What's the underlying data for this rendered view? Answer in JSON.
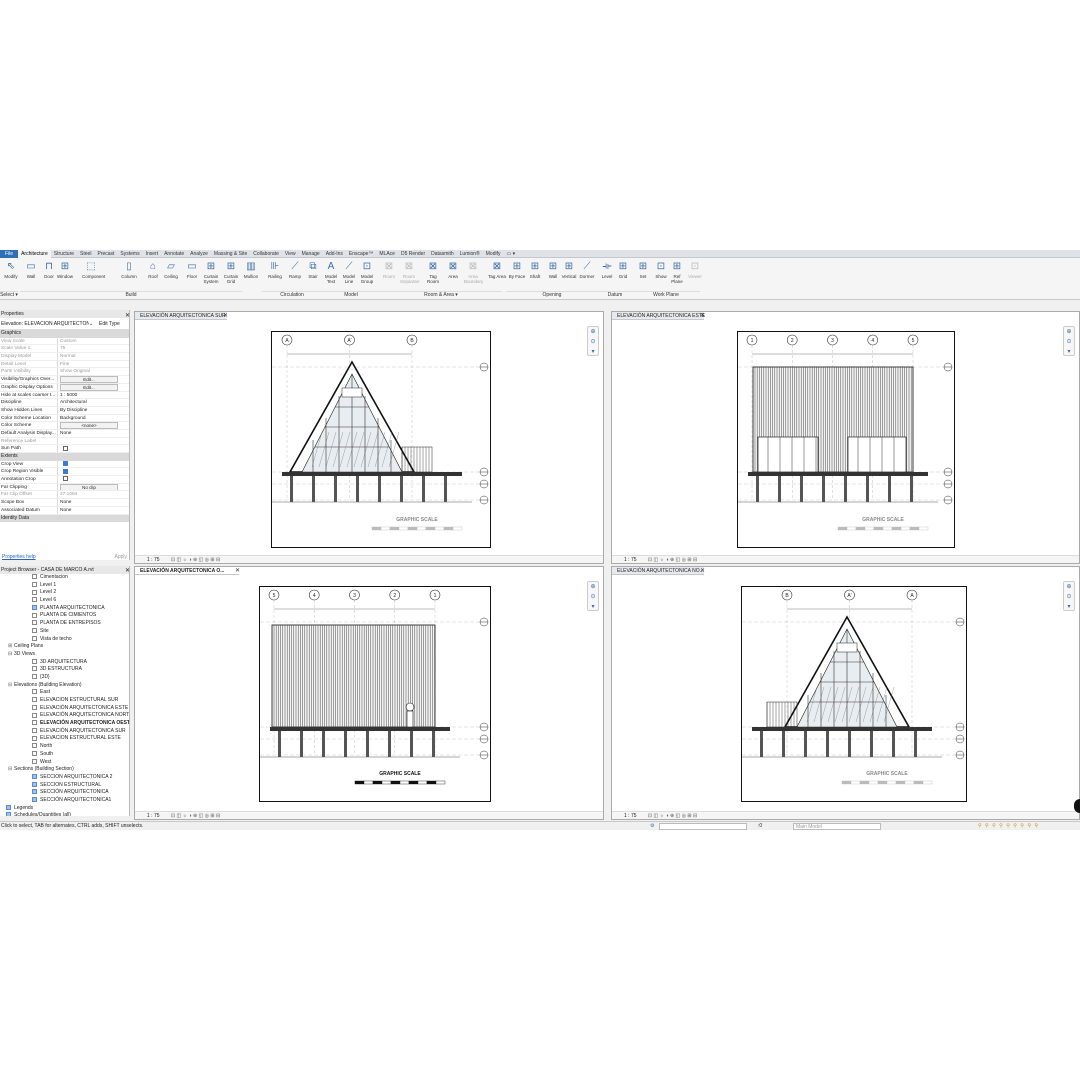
{
  "ribbon_tabs": [
    "File",
    "Architecture",
    "Structure",
    "Steel",
    "Precast",
    "Systems",
    "Insert",
    "Annotate",
    "Analyze",
    "Massing & Site",
    "Collaborate",
    "View",
    "Manage",
    "Add-Ins",
    "Enscape™",
    "MLAce",
    "D5 Render",
    "Datasmith",
    "Lumion®",
    "Modify"
  ],
  "ribbon_buttons": [
    {
      "label": "Modify",
      "icon": "cursor-icon"
    },
    {
      "label": "Wall",
      "icon": "wall-icon"
    },
    {
      "label": "Door",
      "icon": "door-icon"
    },
    {
      "label": "Window",
      "icon": "window-icon"
    },
    {
      "label": "Component",
      "icon": "component-icon"
    },
    {
      "label": "Column",
      "icon": "column-icon"
    },
    {
      "label": "Roof",
      "icon": "roof-icon"
    },
    {
      "label": "Ceiling",
      "icon": "ceiling-icon"
    },
    {
      "label": "Floor",
      "icon": "floor-icon"
    },
    {
      "label": "Curtain System",
      "icon": "curtain-system-icon"
    },
    {
      "label": "Curtain Grid",
      "icon": "curtain-grid-icon"
    },
    {
      "label": "Mullion",
      "icon": "mullion-icon"
    },
    {
      "label": "Railing",
      "icon": "railing-icon"
    },
    {
      "label": "Ramp",
      "icon": "ramp-icon"
    },
    {
      "label": "Stair",
      "icon": "stair-icon"
    },
    {
      "label": "Model Text",
      "icon": "model-text-icon"
    },
    {
      "label": "Model Line",
      "icon": "model-line-icon"
    },
    {
      "label": "Model Group",
      "icon": "model-group-icon"
    },
    {
      "label": "Room",
      "icon": "room-icon",
      "dim": true
    },
    {
      "label": "Room Separator",
      "icon": "room-separator-icon",
      "dim": true
    },
    {
      "label": "Tag Room",
      "icon": "tag-room-icon"
    },
    {
      "label": "Area",
      "icon": "area-icon"
    },
    {
      "label": "Area Boundary",
      "icon": "area-boundary-icon",
      "dim": true
    },
    {
      "label": "Tag Area",
      "icon": "tag-area-icon"
    },
    {
      "label": "By Face",
      "icon": "by-face-icon"
    },
    {
      "label": "Shaft",
      "icon": "shaft-icon"
    },
    {
      "label": "Wall",
      "icon": "wall-opening-icon"
    },
    {
      "label": "Vertical",
      "icon": "vertical-opening-icon"
    },
    {
      "label": "Dormer",
      "icon": "dormer-icon"
    },
    {
      "label": "Level",
      "icon": "level-icon"
    },
    {
      "label": "Grid",
      "icon": "grid-icon"
    },
    {
      "label": "Set",
      "icon": "set-icon"
    },
    {
      "label": "Show",
      "icon": "show-icon"
    },
    {
      "label": "Ref Plane",
      "icon": "ref-plane-icon"
    },
    {
      "label": "Viewer",
      "icon": "viewer-icon",
      "dim": true
    }
  ],
  "ribbon_groups": [
    "Select ▾",
    "Build",
    "Circulation",
    "Model",
    "Room & Area ▾",
    "Opening",
    "Datum",
    "Work Plane"
  ],
  "properties": {
    "title": "Properties",
    "type_selector": "Elevation: ELEVACIÓN ARQUITECTONICA",
    "edit_type": "Edit Type",
    "sections": {
      "graphics": "Graphics",
      "extents": "Extents",
      "identity": "Identity Data"
    },
    "graphics_rows": [
      {
        "k": "View Scale",
        "v": "Custom",
        "grey": true
      },
      {
        "k": "Scale Value    1:",
        "v": "75",
        "grey": true
      },
      {
        "k": "Display Model",
        "v": "Normal",
        "grey": true
      },
      {
        "k": "Detail Level",
        "v": "Fine",
        "grey": true
      },
      {
        "k": "Parts Visibility",
        "v": "Show Original",
        "grey": true
      },
      {
        "k": "Visibility/Graphics Over...",
        "v": "Edit...",
        "btn": true
      },
      {
        "k": "Graphic Display Options",
        "v": "Edit...",
        "btn": true
      },
      {
        "k": "Hide at scales coarser t...",
        "v": "1 : 5000"
      },
      {
        "k": "Discipline",
        "v": "Architectural"
      },
      {
        "k": "Show Hidden Lines",
        "v": "By Discipline"
      },
      {
        "k": "Color Scheme Location",
        "v": "Background"
      },
      {
        "k": "Color Scheme",
        "v": "<none>",
        "btn": true
      },
      {
        "k": "Default Analysis Display...",
        "v": "None"
      },
      {
        "k": "Reference Label",
        "v": "",
        "grey": true
      },
      {
        "k": "Sun Path",
        "v": "",
        "check": false
      }
    ],
    "extents_rows": [
      {
        "k": "Crop View",
        "v": "",
        "check": true
      },
      {
        "k": "Crop Region Visible",
        "v": "",
        "check": true
      },
      {
        "k": "Annotation Crop",
        "v": "",
        "check": false
      },
      {
        "k": "Far Clipping",
        "v": "No clip",
        "btn": true
      },
      {
        "k": "Far Clip Offset",
        "v": "27.1084",
        "grey": true
      },
      {
        "k": "Scope Box",
        "v": "None"
      },
      {
        "k": "Associated Datum",
        "v": "None"
      }
    ],
    "help": "Properties help",
    "apply": "Apply"
  },
  "browser": {
    "title": "Project Browser - CASA DE MARCO A.rvt",
    "items": [
      {
        "t": "Cimentacion",
        "lvl": 2,
        "icon": "sq"
      },
      {
        "t": "Level 1",
        "lvl": 2,
        "icon": "sq"
      },
      {
        "t": "Level 2",
        "lvl": 2,
        "icon": "sq"
      },
      {
        "t": "Level 6",
        "lvl": 2,
        "icon": "sq"
      },
      {
        "t": "PLANTA ARQUITECTONICA",
        "lvl": 2,
        "icon": "bl"
      },
      {
        "t": "PLANTA DE CIMIENTOS",
        "lvl": 2,
        "icon": "sq"
      },
      {
        "t": "PLANTA DE ENTREPISOS",
        "lvl": 2,
        "icon": "sq"
      },
      {
        "t": "Site",
        "lvl": 2,
        "icon": "sq"
      },
      {
        "t": "Vista de techo",
        "lvl": 2,
        "icon": "sq"
      },
      {
        "t": "Ceiling Plans",
        "lvl": 1,
        "icon": "plus"
      },
      {
        "t": "3D Views",
        "lvl": 1,
        "icon": "minus"
      },
      {
        "t": "3D ARQUITECTURA",
        "lvl": 2,
        "icon": "sq"
      },
      {
        "t": "3D ESTRUCTURA",
        "lvl": 2,
        "icon": "sq"
      },
      {
        "t": "{3D}",
        "lvl": 2,
        "icon": "sq"
      },
      {
        "t": "Elevations (Building Elevation)",
        "lvl": 1,
        "icon": "minus"
      },
      {
        "t": "East",
        "lvl": 2,
        "icon": "sq"
      },
      {
        "t": "ELEVACION ESTRUCTURAL SUR",
        "lvl": 2,
        "icon": "sq"
      },
      {
        "t": "ELEVACIÓN ARQUITECTONICA ESTE",
        "lvl": 2,
        "icon": "sq"
      },
      {
        "t": "ELEVACIÓN ARQUITECTONICA NORTE",
        "lvl": 2,
        "icon": "sq"
      },
      {
        "t": "ELEVACIÓN ARQUITECTONICA OESTE",
        "lvl": 2,
        "icon": "sq",
        "bold": true
      },
      {
        "t": "ELEVACIÓN ARQUITECTONICA SUR",
        "lvl": 2,
        "icon": "sq"
      },
      {
        "t": "ELEVACION ESTRUCTURAL ESTE",
        "lvl": 2,
        "icon": "sq"
      },
      {
        "t": "North",
        "lvl": 2,
        "icon": "sq"
      },
      {
        "t": "South",
        "lvl": 2,
        "icon": "sq"
      },
      {
        "t": "West",
        "lvl": 2,
        "icon": "sq"
      },
      {
        "t": "Sections (Building Section)",
        "lvl": 1,
        "icon": "minus"
      },
      {
        "t": "SECCION ARQUITECTONICA 2",
        "lvl": 2,
        "icon": "bl"
      },
      {
        "t": "SECCION ESTRUCTURAL",
        "lvl": 2,
        "icon": "bl"
      },
      {
        "t": "SECCIÓN ARQUITECTONICA",
        "lvl": 2,
        "icon": "bl"
      },
      {
        "t": "SECCIÓN ARQUITECTONICA1",
        "lvl": 2,
        "icon": "bl"
      },
      {
        "t": "Legends",
        "lvl": 0,
        "icon": "bl"
      },
      {
        "t": "Schedules/Quantities (all)",
        "lvl": 0,
        "icon": "bl"
      }
    ]
  },
  "views": [
    {
      "title": "ELEVACIÓN ARQUITECTONICA SUR",
      "scale": "1 : 75",
      "kind": "a-front",
      "scale_label": "GRAPHIC SCALE",
      "grids": [
        "A",
        "A'",
        "B"
      ],
      "active": false
    },
    {
      "title": "ELEVACIÓN ARQUITECTONICA ESTE",
      "scale": "1 : 75",
      "kind": "side",
      "scale_label": "GRAPHIC SCALE",
      "grids": [
        "1",
        "2",
        "3",
        "4",
        "5"
      ],
      "active": false
    },
    {
      "title": "ELEVACIÓN ARQUITECTONICA O...",
      "scale": "1 : 75",
      "kind": "side2",
      "scale_label": "GRAPHIC SCALE",
      "grids": [
        "5",
        "4",
        "3",
        "2",
        "1"
      ],
      "active": true
    },
    {
      "title": "ELEVACIÓN ARQUITECTONICA NO...",
      "scale": "1 : 75",
      "kind": "a-back",
      "scale_label": "GRAPHIC SCALE",
      "grids": [
        "B",
        "A'",
        "A"
      ],
      "active": false
    }
  ],
  "status": {
    "hint": "Click to select, TAB for alternates, CTRL adds, SHIFT unselects.",
    "zero": ":0",
    "model": "Main Model"
  }
}
